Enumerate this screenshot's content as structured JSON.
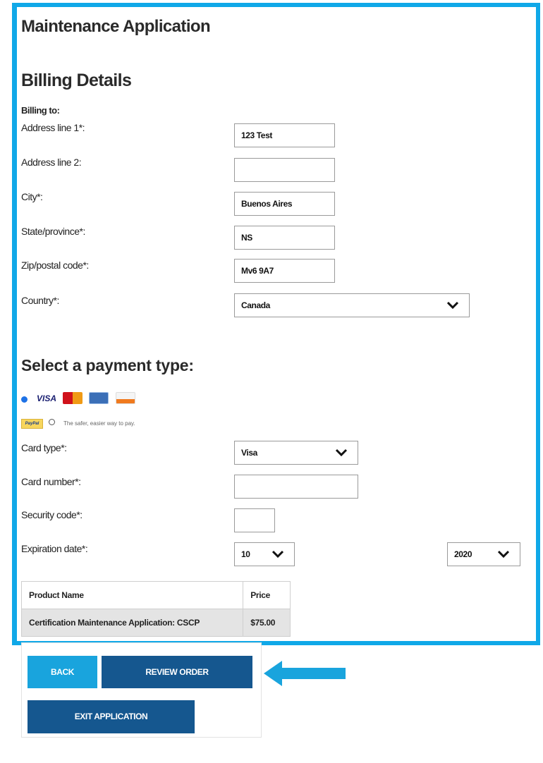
{
  "page": {
    "title": "Maintenance Application",
    "section_title": "Billing Details",
    "billing_to": "Billing to:"
  },
  "billing": {
    "address1": {
      "label": "Address line 1*:",
      "value": "123 Test"
    },
    "address2": {
      "label": "Address line 2:",
      "value": ""
    },
    "city": {
      "label": "City*:",
      "value": "Buenos Aires"
    },
    "state": {
      "label": "State/province*:",
      "value": "NS"
    },
    "zip": {
      "label": "Zip/postal code*:",
      "value": "Mv6 9A7"
    },
    "country": {
      "label": "Country*:",
      "value": "Canada"
    }
  },
  "payment": {
    "title": "Select a payment type:",
    "visa_text": "VISA",
    "paypal_text": "PayPal",
    "paypal_tagline": "The safer, easier way to pay.",
    "card_type": {
      "label": "Card type*:",
      "value": "Visa"
    },
    "card_number": {
      "label": "Card number*:",
      "value": ""
    },
    "security_code": {
      "label": "Security code*:",
      "value": ""
    },
    "expiration": {
      "label": "Expiration date*:",
      "month": "10",
      "year": "2020"
    }
  },
  "products": {
    "headers": [
      "Product Name",
      "Price"
    ],
    "rows": [
      [
        "Certification Maintenance Application: CSCP",
        "$75.00"
      ]
    ]
  },
  "buttons": {
    "back": "BACK",
    "review": "REVIEW ORDER",
    "exit": "EXIT APPLICATION"
  },
  "colors": {
    "highlight_border": "#10a8e8",
    "primary_button": "#15578f",
    "secondary_button": "#19a4dd",
    "arrow": "#19a4dd"
  },
  "icons": {
    "dropdown": "chevron-down-icon",
    "pointer": "arrow-left-icon"
  }
}
